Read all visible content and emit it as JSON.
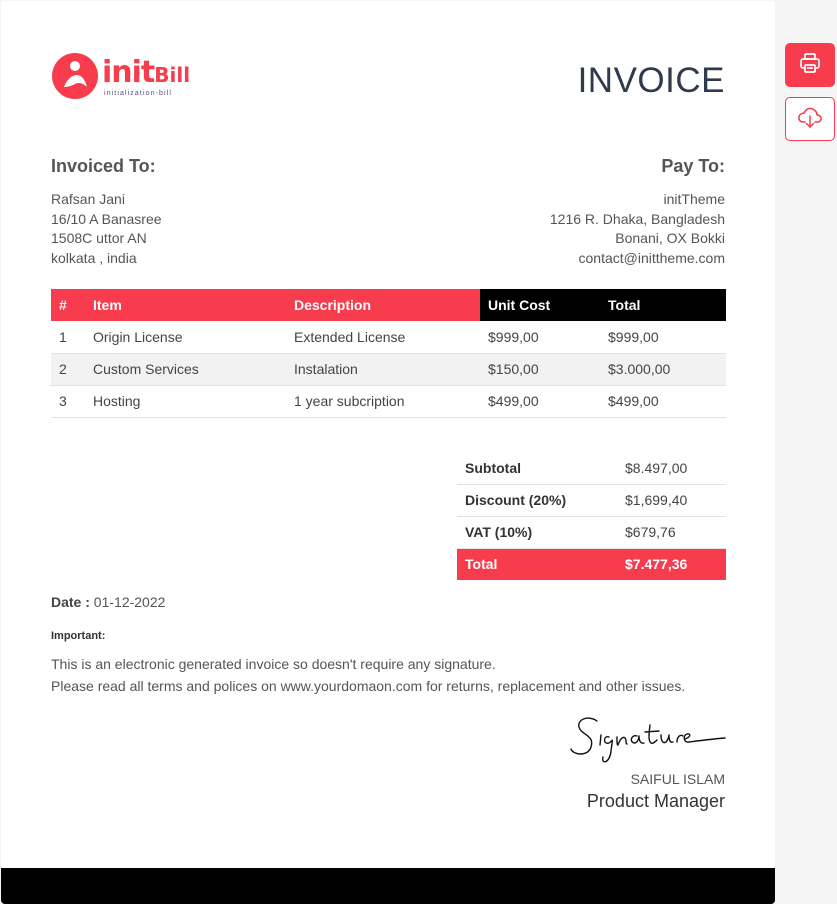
{
  "brand": {
    "name_main": "init",
    "name_accent": "Bill",
    "tagline": "initialization-bill",
    "accent": "#f73d4d"
  },
  "title": "INVOICE",
  "invoiced_to": {
    "heading": "Invoiced To:",
    "lines": [
      "Rafsan Jani",
      "16/10 A Banasree",
      "1508C uttor AN",
      "kolkata , india"
    ]
  },
  "pay_to": {
    "heading": "Pay To:",
    "lines": [
      "initTheme",
      "1216 R. Dhaka, Bangladesh",
      "Bonani, OX Bokki",
      "contact@inittheme.com"
    ]
  },
  "items_table": {
    "headers": [
      "#",
      "Item",
      "Description",
      "Unit Cost",
      "Total"
    ],
    "rows": [
      [
        "1",
        "Origin License",
        "Extended License",
        "$999,00",
        "$999,00"
      ],
      [
        "2",
        "Custom Services",
        "Instalation",
        "$150,00",
        "$3.000,00"
      ],
      [
        "3",
        "Hosting",
        "1 year subcription",
        "$499,00",
        "$499,00"
      ]
    ]
  },
  "totals": [
    {
      "label": "Subtotal",
      "value": "$8.497,00"
    },
    {
      "label": "Discount (20%)",
      "value": "$1,699,40"
    },
    {
      "label": "VAT (10%)",
      "value": "$679,76"
    },
    {
      "label": "Total",
      "value": "$7.477,36"
    }
  ],
  "date": {
    "label": "Date :",
    "value": "01-12-2022"
  },
  "important": {
    "heading": "Important:",
    "lines": [
      "This is an electronic generated invoice so doesn't require any signature.",
      "Please read all terms and polices on www.yourdomaon.com for returns, replacement and other issues."
    ]
  },
  "signer": {
    "signature_text": "Signature",
    "name": "SAIFUL ISLAM",
    "role": "Product Manager"
  },
  "side_actions": [
    {
      "icon": "printer-icon"
    },
    {
      "icon": "cloud-download-icon"
    }
  ]
}
